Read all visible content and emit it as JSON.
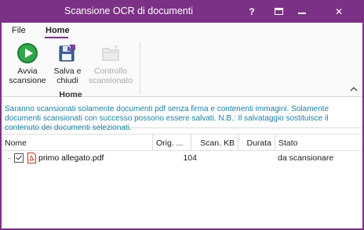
{
  "window": {
    "title": "Scansione OCR di documenti",
    "help_label": "?",
    "close_label": "✕",
    "accent_color": "#7b3185"
  },
  "ribbon": {
    "tabs": [
      {
        "label": "File",
        "active": false
      },
      {
        "label": "Home",
        "active": true
      }
    ],
    "buttons": [
      {
        "label": "Avvia scansione",
        "icon": "play-icon",
        "enabled": true
      },
      {
        "label": "Salva e chiudi",
        "icon": "save-close-icon",
        "enabled": true
      },
      {
        "label": "Controllo scansionato",
        "icon": "folder-icon",
        "enabled": false
      }
    ],
    "group_label": "Home"
  },
  "info": {
    "message": "Saranno scansionati solamente documenti pdf senza firma e contenenti immagini. Solamente documenti scansionati con successo possono essere salvati. N.B.: Il salvataggio sostituisce il contenuto dei documenti selezionati.",
    "color": "#1a7fa5"
  },
  "table": {
    "columns": [
      "Nome",
      "Orig. ...",
      "Scan. KB",
      "Durata",
      "Stato"
    ],
    "rows": [
      {
        "checked": true,
        "name": "primo allegato.pdf",
        "orig": "104",
        "scan": "",
        "durata": "",
        "stato": "da scansionare"
      }
    ]
  }
}
